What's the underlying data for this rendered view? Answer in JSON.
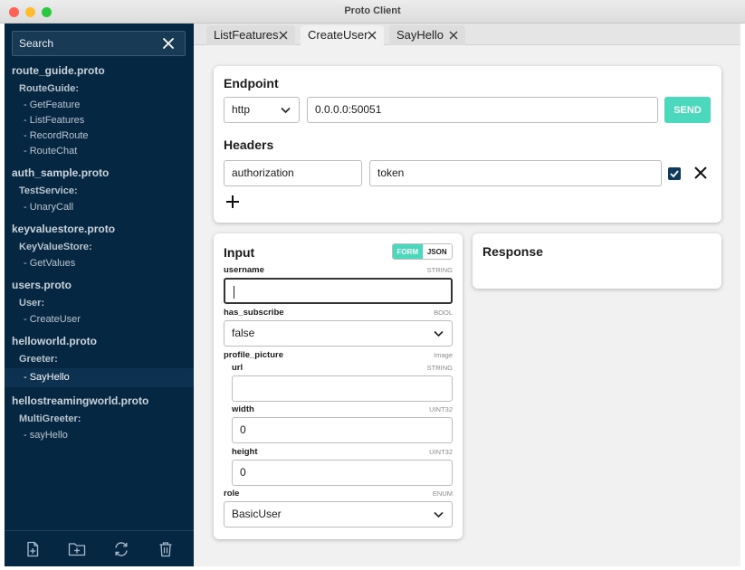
{
  "window": {
    "title": "Proto Client"
  },
  "search": {
    "placeholder": "Search"
  },
  "tree": [
    {
      "file": "route_guide.proto",
      "service": "RouteGuide:",
      "methods": [
        "- GetFeature",
        "- ListFeatures",
        "- RecordRoute",
        "- RouteChat"
      ]
    },
    {
      "file": "auth_sample.proto",
      "service": "TestService:",
      "methods": [
        "- UnaryCall"
      ]
    },
    {
      "file": "keyvaluestore.proto",
      "service": "KeyValueStore:",
      "methods": [
        "- GetValues"
      ]
    },
    {
      "file": "users.proto",
      "service": "User:",
      "methods": [
        "- CreateUser"
      ]
    },
    {
      "file": "helloworld.proto",
      "service": "Greeter:",
      "methods": [
        "- SayHello"
      ]
    },
    {
      "file": "hellostreamingworld.proto",
      "service": "MultiGreeter:",
      "methods": [
        "- sayHello"
      ]
    }
  ],
  "tabs": [
    {
      "label": "ListFeatures"
    },
    {
      "label": "CreateUser"
    },
    {
      "label": "SayHello"
    }
  ],
  "endpoint": {
    "heading": "Endpoint",
    "protocol": "http",
    "address": "0.0.0.0:50051",
    "send_label": "SEND"
  },
  "headers": {
    "heading": "Headers",
    "key": "authorization",
    "value": "token"
  },
  "input": {
    "heading": "Input",
    "mode_form": "FORM",
    "mode_json": "JSON",
    "fields": {
      "username": {
        "label": "username",
        "type": "STRING",
        "value": ""
      },
      "has_subscribe": {
        "label": "has_subscribe",
        "type": "BOOL",
        "value": "false"
      },
      "profile_picture": {
        "label": "profile_picture",
        "type": "Image"
      },
      "url": {
        "label": "url",
        "type": "STRING",
        "value": ""
      },
      "width": {
        "label": "width",
        "type": "UINT32",
        "value": "0"
      },
      "height": {
        "label": "height",
        "type": "UINT32",
        "value": "0"
      },
      "role": {
        "label": "role",
        "type": "ENUM",
        "value": "BasicUser"
      }
    }
  },
  "response": {
    "heading": "Response"
  },
  "colors": {
    "sidebar": "#062741",
    "accent": "#4bd8bd",
    "checkbox": "#0e3a5c"
  },
  "icons": {
    "footer": [
      "add-file-icon",
      "add-folder-icon",
      "refresh-icon",
      "trash-icon"
    ]
  }
}
